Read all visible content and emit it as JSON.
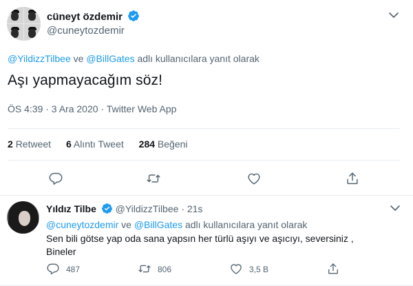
{
  "main_tweet": {
    "display_name": "cüneyt özdemir",
    "handle": "@cuneytozdemir",
    "reply_context": {
      "mention1": "@YildizzTilbee",
      "joiner": " ve ",
      "mention2": "@BillGates",
      "suffix": " adlı kullanıcılara yanıt olarak"
    },
    "text": "Aşı yapmayacağım söz!",
    "meta": "ÖS 4:39 · 3 Ara 2020 · Twitter Web App",
    "stats": {
      "retweet_count": "2",
      "retweet_label": "Retweet",
      "quote_count": "6",
      "quote_label": "Alıntı Tweet",
      "like_count": "284",
      "like_label": "Beğeni"
    }
  },
  "reply_tweet": {
    "display_name": "Yıldız Tilbe",
    "handle": "@YildizzTilbee",
    "time": "· 21s",
    "reply_context": {
      "mention1": "@cuneytozdemir",
      "joiner": " ve ",
      "mention2": "@BillGates",
      "suffix": " adlı kullanıcılara yanıt olarak"
    },
    "text_line1": "Sen bili götse yap oda sana yapsın her türlü aşıyı ve aşıcıyı, seversiniz ,",
    "text_line2": "Bineler",
    "actions": {
      "reply_count": "487",
      "retweet_count": "806",
      "like_count": "3,5 B"
    }
  },
  "colors": {
    "link": "#1d9bf0",
    "verified": "#1d9bf0",
    "muted": "#536471",
    "text": "#0f1419",
    "divider": "#e6ecf0"
  },
  "icons": [
    "verified-badge-icon",
    "chevron-down-icon",
    "reply-icon",
    "retweet-icon",
    "like-icon",
    "share-icon"
  ]
}
